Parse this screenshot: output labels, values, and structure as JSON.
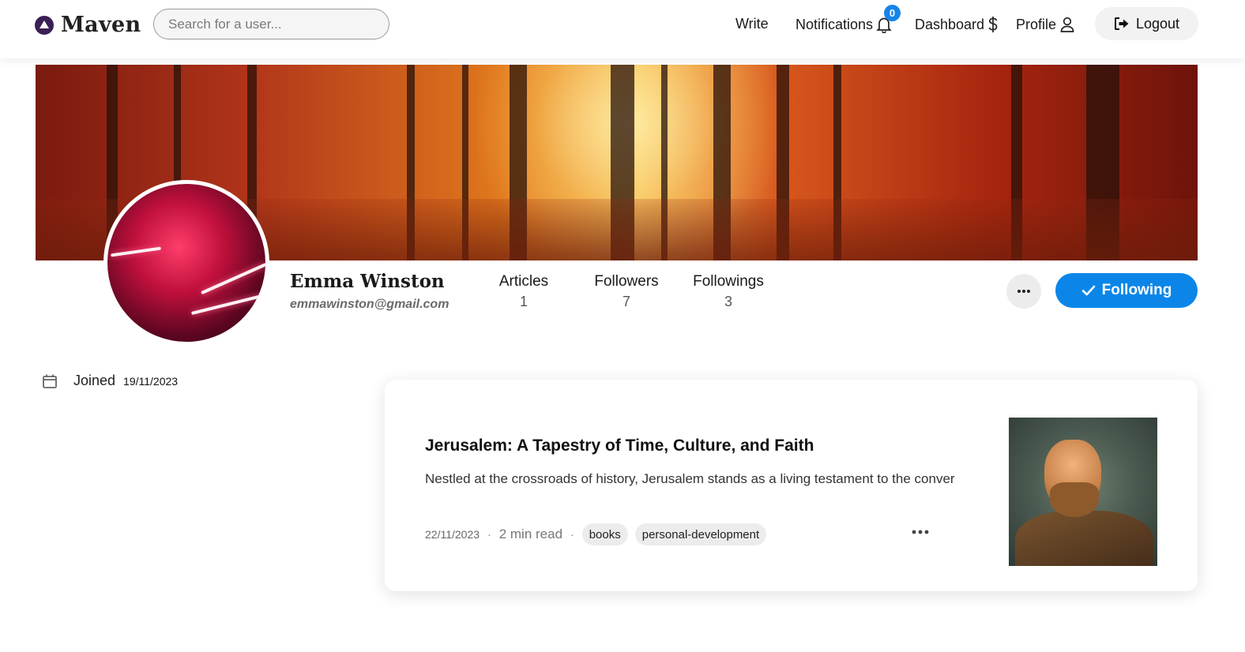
{
  "navbar": {
    "brand": "Maven",
    "search_placeholder": "Search for a user...",
    "write": "Write",
    "notifications": "Notifications",
    "notification_count": "0",
    "dashboard": "Dashboard",
    "profile": "Profile",
    "logout": "Logout"
  },
  "profile": {
    "name": "Emma Winston",
    "email": "emmawinston@gmail.com",
    "stats": [
      {
        "label": "Articles",
        "value": "1"
      },
      {
        "label": "Followers",
        "value": "7"
      },
      {
        "label": "Followings",
        "value": "3"
      }
    ],
    "follow_label": "Following",
    "joined_label": "Joined",
    "joined_date": "19/11/2023"
  },
  "articles": [
    {
      "title": "Jerusalem: A Tapestry of Time, Culture, and Faith",
      "excerpt": "Nestled at the crossroads of history, Jerusalem stands as a living testament to the conver",
      "date": "22/11/2023",
      "read_time": "2 min read",
      "tags": [
        "books",
        "personal-development"
      ]
    }
  ],
  "colors": {
    "accent": "#0b86e8",
    "badge": "#1684e9",
    "brand": "#3b1f55"
  }
}
